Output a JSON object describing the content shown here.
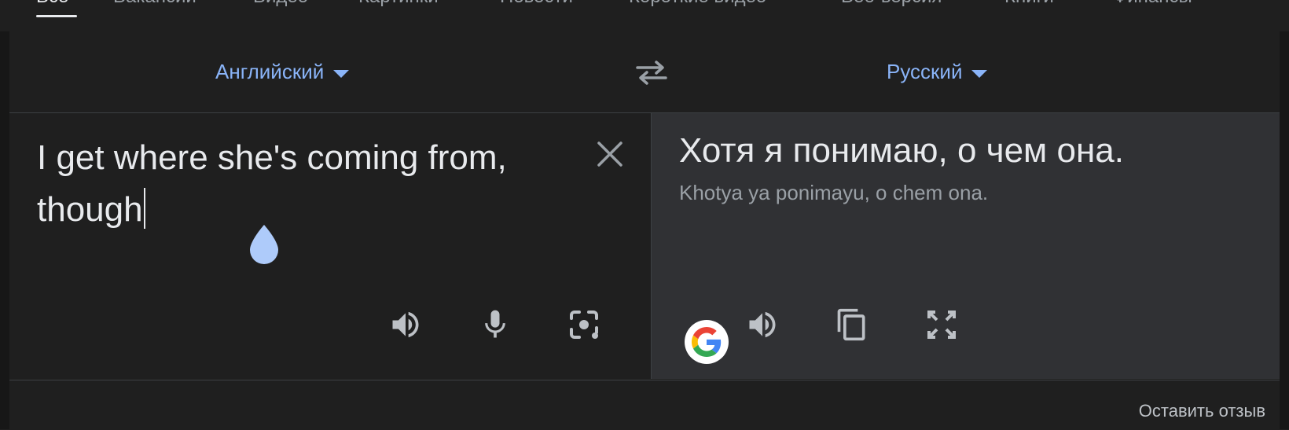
{
  "tabs": [
    {
      "label": "Все",
      "active": true
    },
    {
      "label": "Вакансии"
    },
    {
      "label": "Видео"
    },
    {
      "label": "Картинки"
    },
    {
      "label": "Новости"
    },
    {
      "label": "Короткие видео"
    },
    {
      "label": "Веб-версия"
    },
    {
      "label": "Книги"
    },
    {
      "label": "Финансы"
    }
  ],
  "translator": {
    "source_lang": "Английский",
    "target_lang": "Русский",
    "source_text": "I get where she's coming from, though",
    "target_text": "Хотя я понимаю, о чем она.",
    "transliteration": "Khotya ya ponimayu, o chem ona."
  },
  "icons": {
    "swap": "swap-arrows-icon",
    "clear": "close-icon",
    "listen_source": "speaker-icon",
    "mic": "microphone-icon",
    "camera": "camera-icon",
    "google": "google-logo-icon",
    "listen_target": "speaker-icon",
    "copy": "copy-icon",
    "fullscreen": "fullscreen-icon"
  },
  "colors": {
    "accent": "#8ab4f8",
    "background": "#1f1f1f",
    "target_panel": "#303134"
  },
  "footer": {
    "feedback": "Оставить отзыв"
  }
}
